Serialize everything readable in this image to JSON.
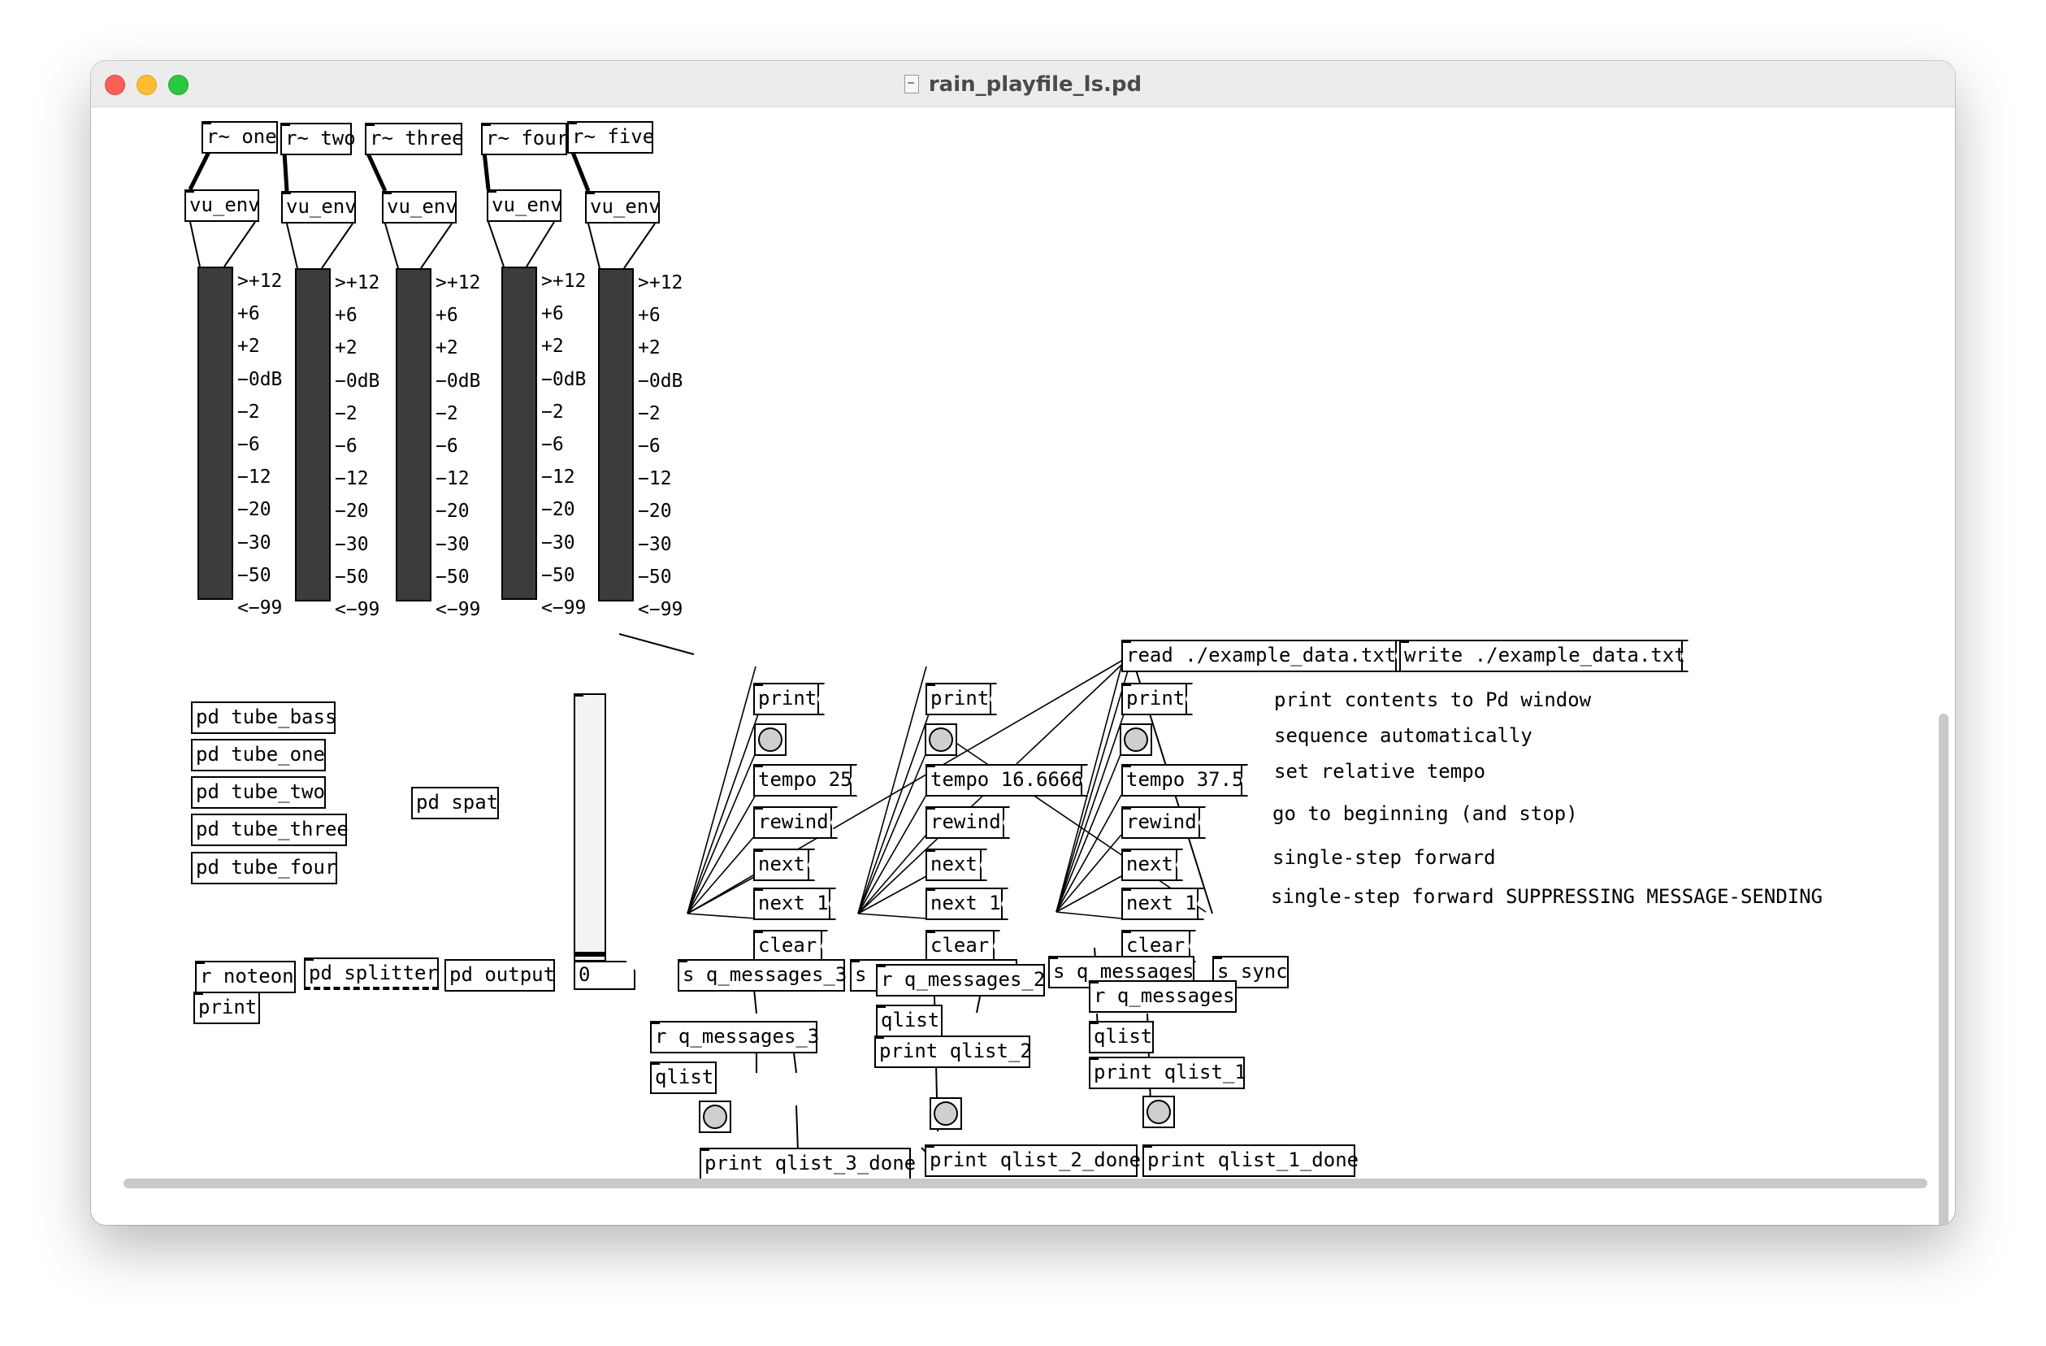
{
  "window": {
    "title": "rain_playfile_ls.pd"
  },
  "receivers": [
    "r~ one",
    "r~ two",
    "r~ three",
    "r~ four",
    "r~ five"
  ],
  "vu_env_label": "vu_env",
  "vu_scale": ">+12\n+6\n+2\n−0dB\n−2\n−6\n−12\n−20\n−30\n−50\n<−99",
  "subpatches": {
    "tube_bass": "pd tube_bass",
    "tube_one": "pd tube_one",
    "tube_two": "pd tube_two",
    "tube_three": "pd tube_three",
    "tube_four": "pd tube_four",
    "spat": "pd spat",
    "splitter": "pd splitter",
    "output": "pd output"
  },
  "misc": {
    "r_noteon": "r noteon",
    "print": "print",
    "number_value": "0"
  },
  "seq_columns": [
    {
      "print": "print",
      "tempo": "tempo 25",
      "rewind": "rewind",
      "next": "next",
      "next1": "next 1",
      "clear": "clear",
      "send": "s q_messages_3"
    },
    {
      "print": "print",
      "tempo": "tempo 16.6666",
      "rewind": "rewind",
      "next": "next",
      "next1": "next 1",
      "clear": "clear",
      "send": "s q_messages_2"
    },
    {
      "print": "print",
      "tempo": "tempo 37.5",
      "rewind": "rewind",
      "next": "next",
      "next1": "next 1",
      "clear": "clear",
      "send": "s q_messages"
    }
  ],
  "read_msg": "read ./example_data.txt",
  "write_msg": "write ./example_data.txt",
  "sync": "s sync",
  "comments": [
    "print contents to Pd window",
    "sequence automatically",
    "set relative tempo",
    "go to beginning (and stop)",
    "single-step forward",
    "single-step forward SUPPRESSING MESSAGE-SENDING"
  ],
  "qlists": {
    "r3": "r q_messages_3",
    "r2": "r q_messages_2",
    "r1": "r q_messages",
    "qlist": "qlist",
    "print2": "print qlist_2",
    "print1": "print qlist_1",
    "done3": "print qlist_3_done",
    "done2": "print qlist_2_done",
    "done1": "print qlist_1_done"
  }
}
